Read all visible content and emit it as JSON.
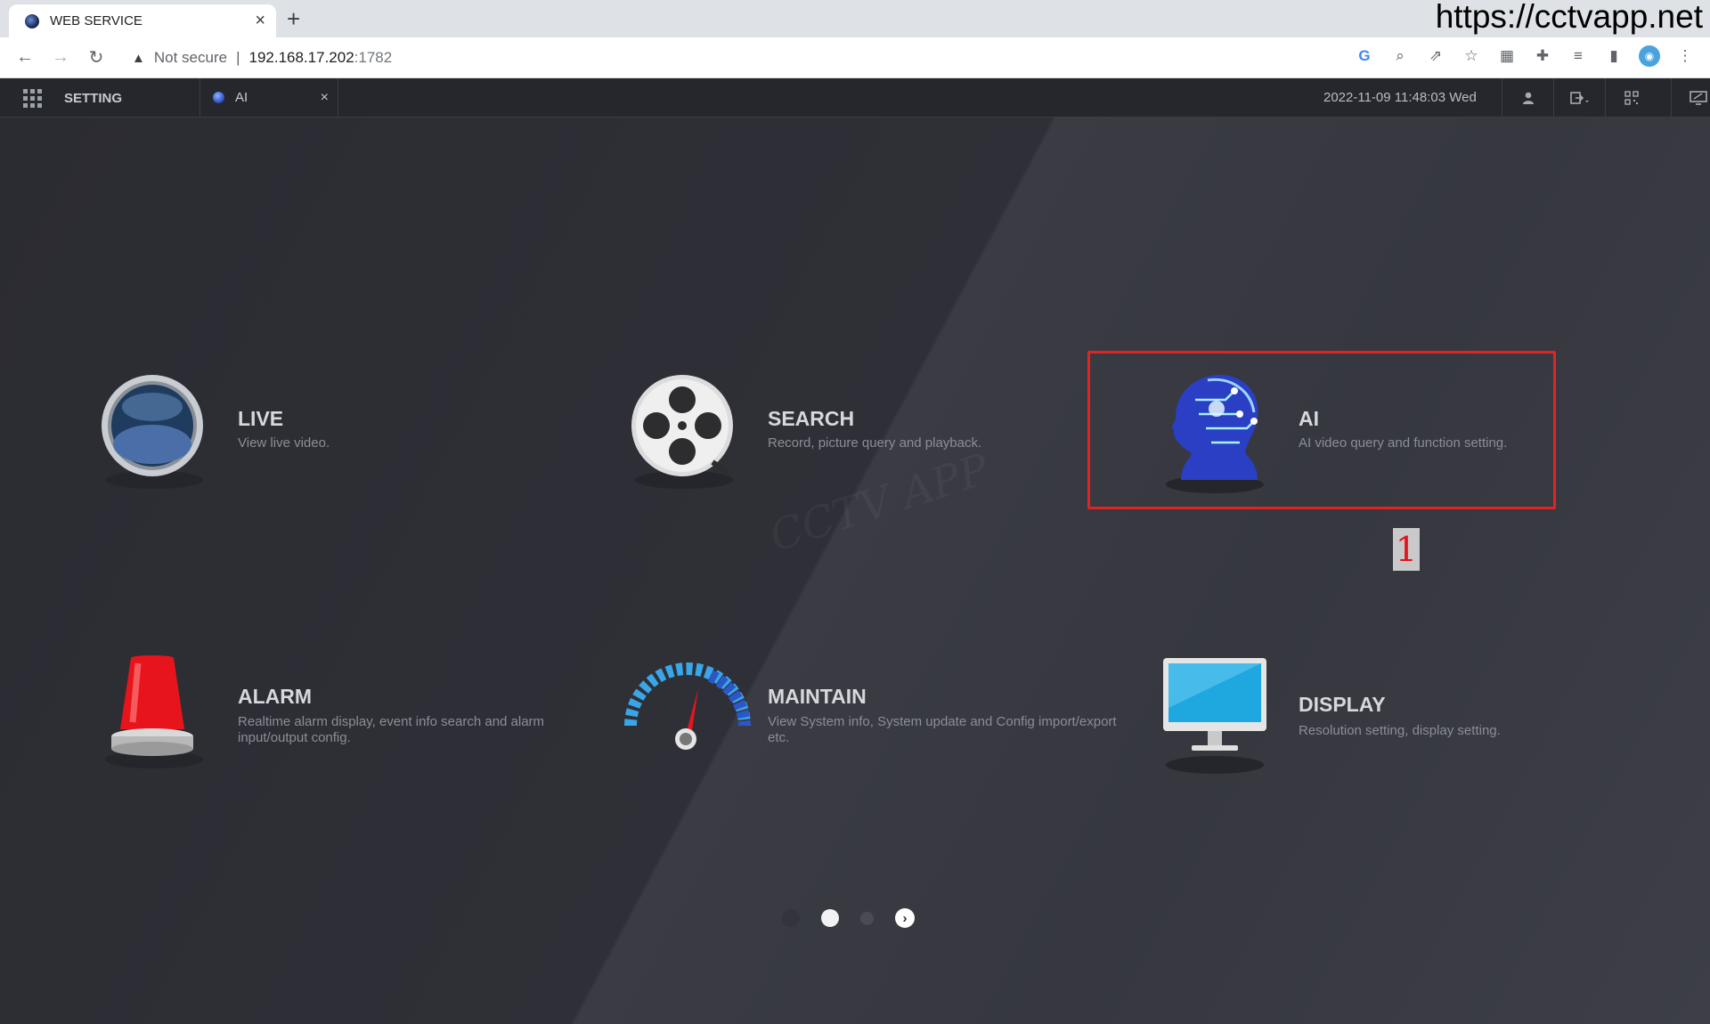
{
  "browser": {
    "tab_title": "WEB SERVICE",
    "new_tab": "+",
    "overlay_url": "https://cctvapp.net",
    "security_text": "Not secure",
    "url_host": "192.168.17.202",
    "url_port": ":1782",
    "toolbar_icons": [
      "google-icon",
      "zoom-icon",
      "share-icon",
      "star-icon",
      "qr-icon",
      "extensions-icon",
      "media-icon",
      "sidepanel-icon",
      "profile-icon",
      "menu-icon"
    ]
  },
  "header": {
    "setting_label": "SETTING",
    "tab_label": "AI",
    "datetime": "2022-11-09 11:48:03 Wed"
  },
  "tiles": {
    "live": {
      "name": "LIVE",
      "desc": "View live video."
    },
    "search": {
      "name": "SEARCH",
      "desc": "Record, picture query and playback."
    },
    "ai": {
      "name": "AI",
      "desc": "AI video query and function setting."
    },
    "alarm": {
      "name": "ALARM",
      "desc": "Realtime alarm display, event info search and alarm input/output config."
    },
    "maintain": {
      "name": "MAINTAIN",
      "desc": "View System info, System update and Config import/export etc."
    },
    "display": {
      "name": "DISPLAY",
      "desc": "Resolution setting, display setting."
    }
  },
  "annotation": {
    "step_number": "1",
    "highlight_color": "#e02424"
  },
  "watermark": "CCTV APP",
  "pager": {
    "pages": 3,
    "current_page": 2
  }
}
